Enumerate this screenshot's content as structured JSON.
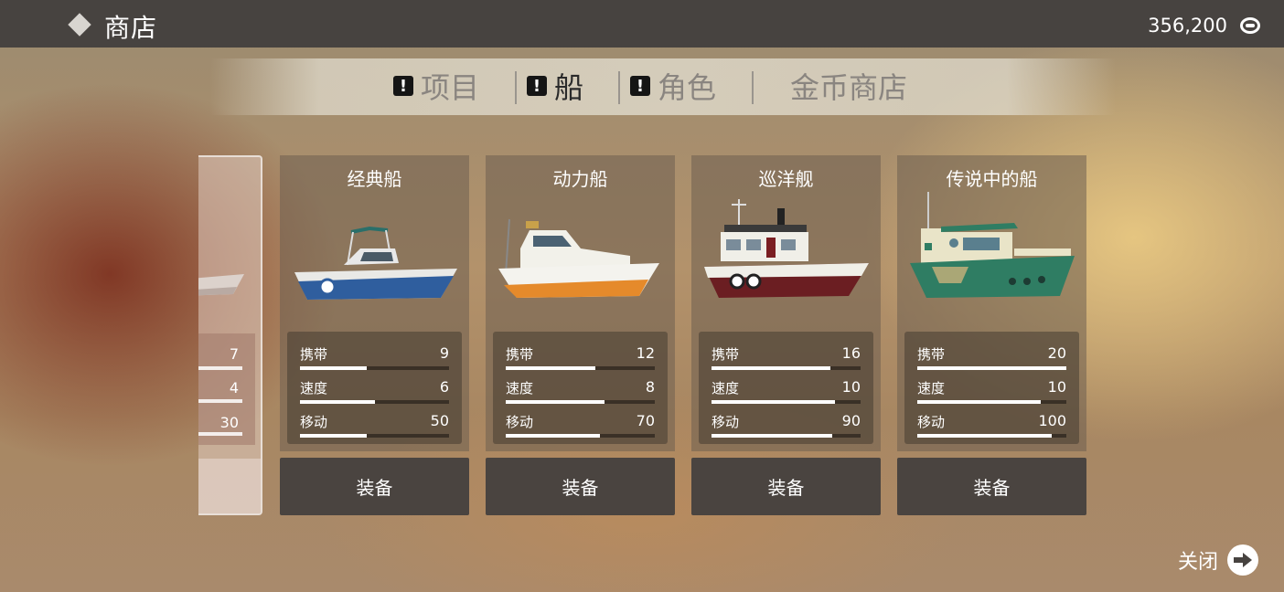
{
  "header": {
    "title": "商店",
    "coins": "356,200",
    "coin_icon": "coin-icon"
  },
  "tabs": [
    {
      "label": "项目",
      "alert": "!",
      "active": false
    },
    {
      "label": "船",
      "alert": "!",
      "active": true
    },
    {
      "label": "角色",
      "alert": "!",
      "active": false
    },
    {
      "label": "金币商店",
      "alert": "",
      "active": false
    }
  ],
  "partial_card": {
    "values": [
      "7",
      "4",
      "30"
    ]
  },
  "stat_labels": {
    "carry": "携带",
    "speed": "速度",
    "move": "移动"
  },
  "cards": [
    {
      "name": "经典船",
      "carry": "9",
      "speed": "6",
      "move": "50",
      "carry_pct": 0.45,
      "speed_pct": 0.5,
      "move_pct": 0.45,
      "button": "装备",
      "hull_color": "#2f5e9e"
    },
    {
      "name": "动力船",
      "carry": "12",
      "speed": "8",
      "move": "70",
      "carry_pct": 0.6,
      "speed_pct": 0.66,
      "move_pct": 0.63,
      "button": "装备",
      "hull_color": "#f0efe8"
    },
    {
      "name": "巡洋舰",
      "carry": "16",
      "speed": "10",
      "move": "90",
      "carry_pct": 0.8,
      "speed_pct": 0.83,
      "move_pct": 0.81,
      "button": "装备",
      "hull_color": "#6b1e22"
    },
    {
      "name": "传说中的船",
      "carry": "20",
      "speed": "10",
      "move": "100",
      "carry_pct": 1.0,
      "speed_pct": 0.83,
      "move_pct": 0.9,
      "button": "装备",
      "hull_color": "#2f7d63"
    }
  ],
  "close": {
    "label": "关闭",
    "icon": "arrow-right-icon"
  }
}
